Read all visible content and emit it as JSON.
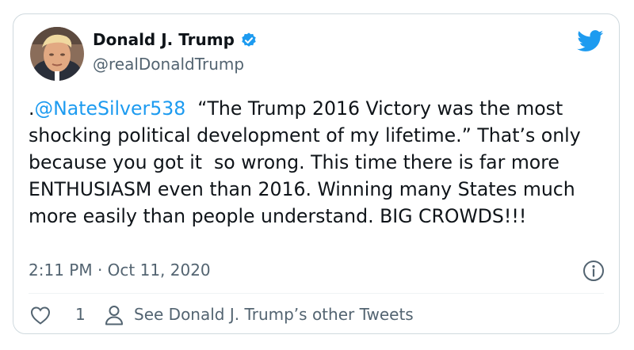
{
  "author": {
    "display_name": "Donald J. Trump",
    "handle": "@realDonaldTrump",
    "verified": true
  },
  "tweet": {
    "prefix": ".",
    "mention": "@NateSilver538",
    "body": "  “The Trump 2016 Victory was the most shocking political development of my lifetime.” That’s only because you got it  so wrong. This time there is far more ENTHUSIASM even than 2016. Winning many States much more easily than people understand. BIG CROWDS!!!",
    "timestamp": "2:11 PM · Oct 11, 2020"
  },
  "actions": {
    "like_count": "1",
    "other_tweets_label": "See Donald J. Trump’s other Tweets"
  },
  "icons": [
    "verified-badge-icon",
    "twitter-bird-icon",
    "info-icon",
    "heart-icon",
    "person-icon"
  ],
  "colors": {
    "accent": "#1d9bf0",
    "text": "#0f1419",
    "secondary": "#536471",
    "border": "#cfd9de"
  }
}
